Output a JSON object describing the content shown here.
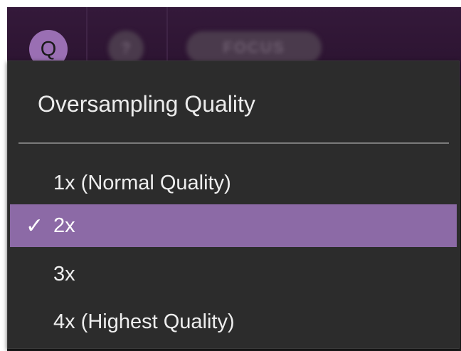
{
  "toolbar": {
    "quality_button_label": "Q",
    "help_button_label": "?",
    "focus_button_label": "FOCUS"
  },
  "menu": {
    "title": "Oversampling Quality",
    "items": [
      {
        "label": "1x (Normal Quality)",
        "check": ""
      },
      {
        "label": "2x",
        "check": "✓"
      },
      {
        "label": "3x",
        "check": ""
      },
      {
        "label": "4x (Highest Quality)",
        "check": ""
      }
    ],
    "selected_label": "2x"
  },
  "colors": {
    "accent": "#8c6aa6",
    "toolbar_bg": "#2e1533",
    "menu_bg": "#2c2c2c"
  }
}
